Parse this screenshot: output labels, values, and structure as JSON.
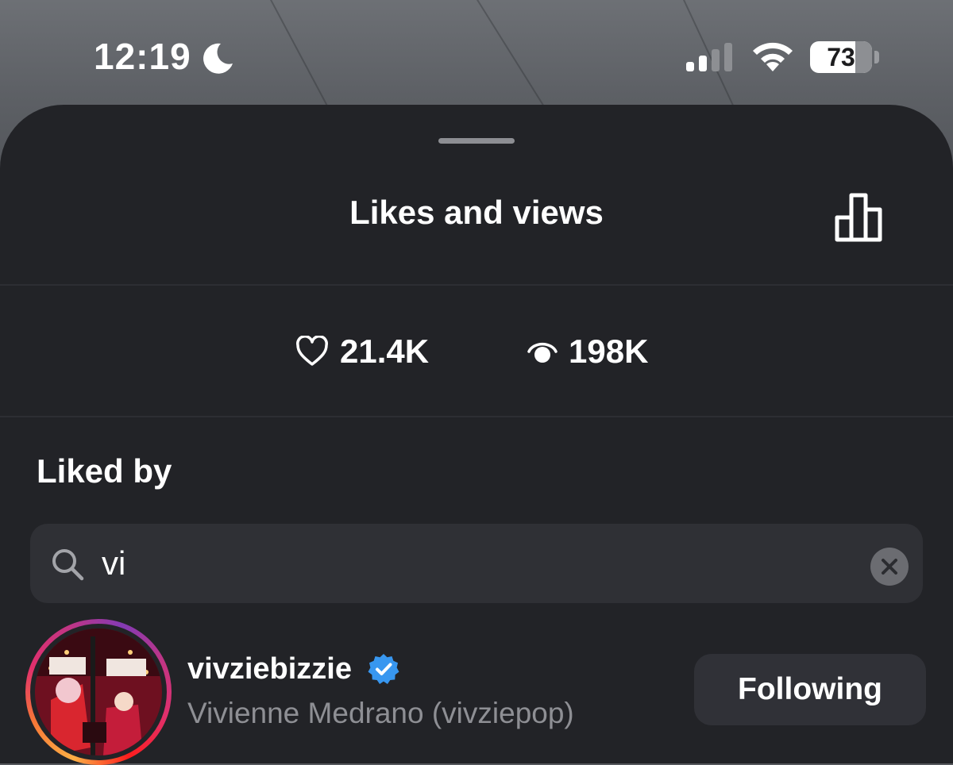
{
  "status_bar": {
    "time": "12:19",
    "battery_percent": "73",
    "battery_level": 0.73,
    "icons": [
      "moon-icon",
      "signal-icon",
      "wifi-icon",
      "battery-icon"
    ]
  },
  "sheet": {
    "title": "Likes and views",
    "insights_icon": "bar-chart-icon"
  },
  "stats": {
    "likes": "21.4K",
    "views": "198K",
    "likes_icon": "heart-icon",
    "views_icon": "eye-icon"
  },
  "liked_by": {
    "heading": "Liked by",
    "search": {
      "value": "vi",
      "icon": "search-icon",
      "clear_icon": "clear-icon"
    },
    "results": [
      {
        "username": "vivziebizzie",
        "verified": true,
        "full_name": "Vivienne Medrano (vivziepop)",
        "button_label": "Following"
      }
    ]
  },
  "colors": {
    "sheet_background": "#222327",
    "field_background": "#2f3035",
    "verified_blue": "#3897f0",
    "secondary_text": "#8e8f94"
  }
}
